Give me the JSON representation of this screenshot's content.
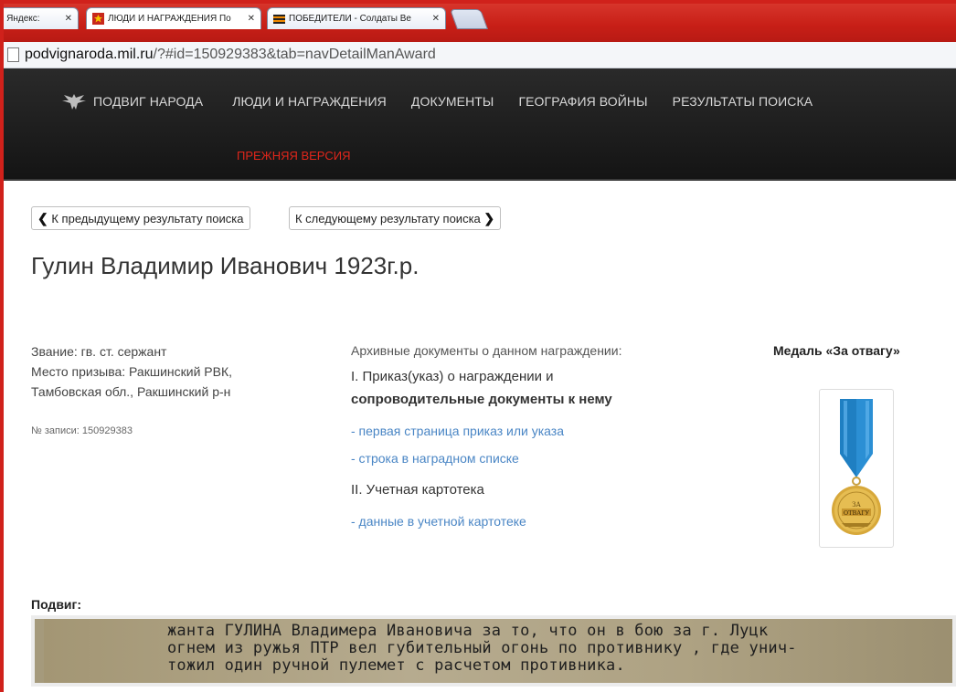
{
  "browser": {
    "tabs": [
      {
        "label": "- Яндекс: ",
        "active": false
      },
      {
        "label": "ЛЮДИ И НАГРАЖДЕНИЯ По",
        "active": true
      },
      {
        "label": "ПОБЕДИТЕЛИ - Солдаты Ве",
        "active": false
      }
    ],
    "url_host": "podvignaroda.mil.ru",
    "url_rest": "/?#id=150929383&tab=navDetailManAward"
  },
  "nav": {
    "brand": "ПОДВИГ НАРОДА",
    "items": [
      "ЛЮДИ И НАГРАЖДЕНИЯ",
      "ДОКУМЕНТЫ",
      "ГЕОГРАФИЯ ВОЙНЫ",
      "РЕЗУЛЬТАТЫ ПОИСКА"
    ],
    "old_version": "ПРЕЖНЯЯ ВЕРСИЯ"
  },
  "pager": {
    "prev": "К предыдущему результату поиска",
    "next": "К следующему результату поиска"
  },
  "person": {
    "name": "Гулин Владимир Иванович 1923г.р.",
    "rank": "Звание: гв. ст. сержант",
    "draft_place_1": "Место призыва: Ракшинский РВК,",
    "draft_place_2": "Тамбовская обл., Ракшинский р-н",
    "record_no": "№ записи: 150929383"
  },
  "documents": {
    "header": "Архивные документы о данном награждении:",
    "section1_line1": "I. Приказ(указ) о награждении и",
    "section1_line2": "сопроводительные документы к нему",
    "link1": "- первая страница приказ или указа",
    "link2": "- строка в наградном списке",
    "section2": "II. Учетная картотека",
    "link3": "- данные в учетной картотеке"
  },
  "award": {
    "title": "Медаль «За отвагу»",
    "medal_text_1": "ЗА",
    "medal_text_2": "ОТВАГУ"
  },
  "feat": {
    "label": "Подвиг:",
    "line1": "жанта ГУЛИНА Владимера Ивановича за то, что он в бою за г. Луцк",
    "line2": "огнем из ружья ПТР вел губительный огонь по противнику , где унич-",
    "line3": "тожил один ручной пулемет с расчетом противника."
  },
  "colors": {
    "frame_red": "#d0211b",
    "link_blue": "#4a86c5",
    "old_version_red": "#e0261b"
  }
}
